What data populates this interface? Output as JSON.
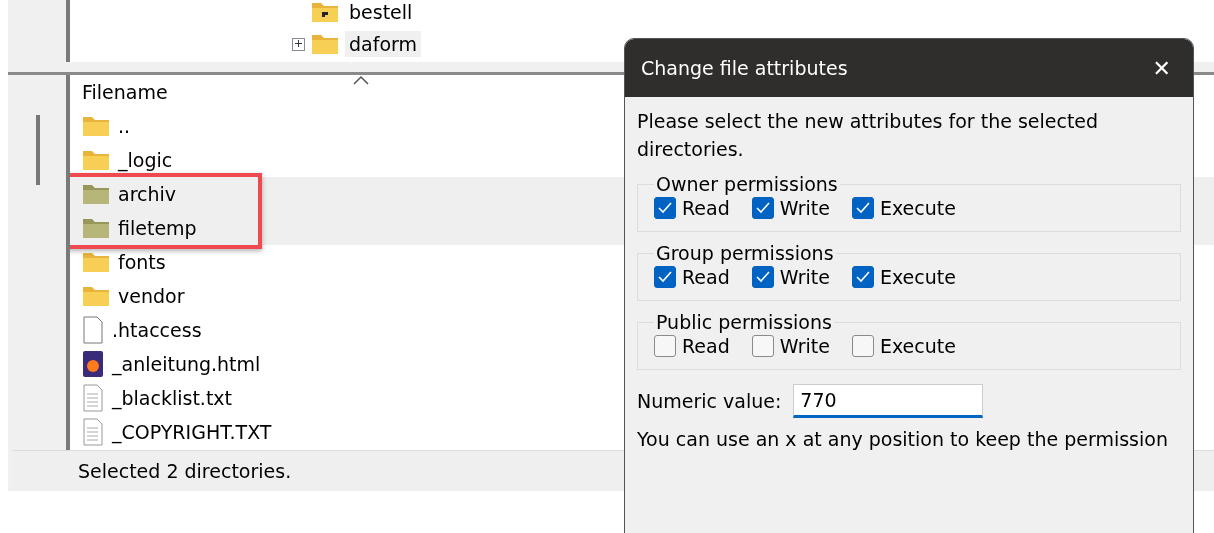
{
  "tree": {
    "items": [
      {
        "label": "bestell",
        "kind": "unknown",
        "expandable": false
      },
      {
        "label": "daform",
        "kind": "folder",
        "expandable": true
      }
    ]
  },
  "file_list": {
    "columns": [
      "Filename"
    ],
    "rows": [
      {
        "name": "..",
        "kind": "folder",
        "selected": false
      },
      {
        "name": "_logic",
        "kind": "folder",
        "selected": false
      },
      {
        "name": "archiv",
        "kind": "folder-dim",
        "selected": true
      },
      {
        "name": "filetemp",
        "kind": "folder-dim",
        "selected": true
      },
      {
        "name": "fonts",
        "kind": "folder",
        "selected": false
      },
      {
        "name": "vendor",
        "kind": "folder",
        "selected": false
      },
      {
        "name": ".htaccess",
        "kind": "file",
        "selected": false
      },
      {
        "name": "_anleitung.html",
        "kind": "html",
        "selected": false
      },
      {
        "name": "_blacklist.txt",
        "kind": "text",
        "selected": false
      },
      {
        "name": "_COPYRIGHT.TXT",
        "kind": "text",
        "selected": false
      }
    ]
  },
  "status_bar": "Selected 2 directories.",
  "dialog": {
    "title": "Change file attributes",
    "close": "✕",
    "intro": "Please select the new attributes for the selected directories.",
    "groups": [
      {
        "title": "Owner permissions",
        "options": [
          {
            "label": "Read",
            "checked": true
          },
          {
            "label": "Write",
            "checked": true
          },
          {
            "label": "Execute",
            "checked": true
          }
        ]
      },
      {
        "title": "Group permissions",
        "options": [
          {
            "label": "Read",
            "checked": true
          },
          {
            "label": "Write",
            "checked": true
          },
          {
            "label": "Execute",
            "checked": true
          }
        ]
      },
      {
        "title": "Public permissions",
        "options": [
          {
            "label": "Read",
            "checked": false
          },
          {
            "label": "Write",
            "checked": false
          },
          {
            "label": "Execute",
            "checked": false
          }
        ]
      }
    ],
    "numeric_label": "Numeric value:",
    "numeric_value": "770",
    "hint": "You can use an x at any position to keep the permission"
  }
}
